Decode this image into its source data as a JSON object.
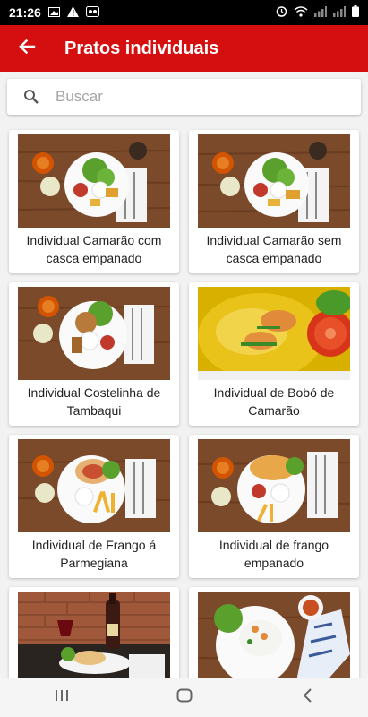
{
  "status_bar": {
    "time": "21:26"
  },
  "app_bar": {
    "title": "Pratos individuais",
    "back_icon": "arrow-back-icon"
  },
  "search": {
    "placeholder": "Buscar",
    "value": ""
  },
  "dishes": [
    {
      "name": "Individual Camarão com casca empanado"
    },
    {
      "name": "Individual Camarão sem casca empanado"
    },
    {
      "name": "Individual Costelinha de Tambaqui"
    },
    {
      "name": "Individual de Bobó de Camarão"
    },
    {
      "name": "Individual de Frango á Parmegiana"
    },
    {
      "name": "Individual de frango empanado"
    },
    {
      "name": ""
    },
    {
      "name": ""
    }
  ],
  "colors": {
    "accent": "#d50f0f",
    "wood": "#7a4a2a"
  }
}
